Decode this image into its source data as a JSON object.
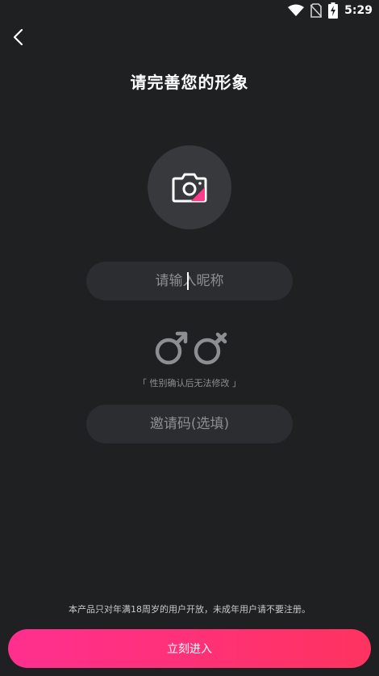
{
  "status_bar": {
    "time": "5:29",
    "icons": [
      "wifi-icon",
      "no-sim-icon",
      "battery-charging-icon"
    ]
  },
  "header": {
    "back_icon": "chevron-left-icon",
    "title": "请完善您的形象"
  },
  "avatar": {
    "icon": "camera-icon",
    "accent_color": "#ff3d8a"
  },
  "nickname": {
    "placeholder": "请输入昵称",
    "value": ""
  },
  "gender": {
    "options": [
      {
        "id": "male",
        "icon": "male-symbol-icon"
      },
      {
        "id": "female",
        "icon": "female-symbol-icon"
      }
    ],
    "note": "「 性别确认后无法修改 」"
  },
  "invite": {
    "placeholder": "邀请码(选填)",
    "value": ""
  },
  "footer": {
    "age_notice": "本产品只对年满18周岁的用户开放，未成年用户请不要注册。",
    "enter_label": "立刻进入",
    "button_gradient": [
      "#ff2f8f",
      "#ff3360"
    ]
  },
  "colors": {
    "background": "#1f2022",
    "input_bg": "#2c2d30",
    "placeholder": "#8d8e91",
    "gender_icon": "#8d8e91"
  }
}
